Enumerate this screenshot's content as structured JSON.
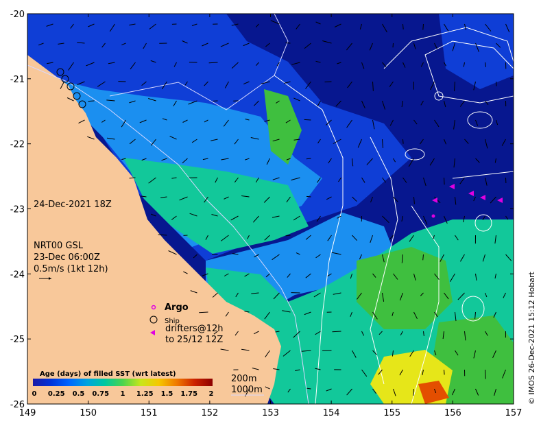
{
  "map": {
    "lon_ticks": [
      "149",
      "150",
      "151",
      "152",
      "153",
      "154",
      "155",
      "156",
      "157"
    ],
    "lat_ticks": [
      "-20",
      "-21",
      "-22",
      "-23",
      "-24",
      "-25",
      "-26"
    ],
    "lon_range": [
      149,
      157
    ],
    "lat_range": [
      -26,
      -20
    ]
  },
  "annotations": {
    "date": "24-Dec-2021 18Z",
    "nrt_line1": "NRT00 GSL",
    "nrt_line2": "23-Dec 06:00Z",
    "nrt_line3": "0.5m/s (1kt 12h)",
    "credit": "© IMOS 26-Dec-2021 15:12 Hobart"
  },
  "legend": {
    "argo": "Argo",
    "ship": "Ship",
    "drifters_line1": "drifters@12h",
    "drifters_line2": "to 25/12 12Z",
    "isobath_200": "200m",
    "isobath_1000": "1000m"
  },
  "colorbar": {
    "title": "Age (days) of filled SST (wrt latest)",
    "tick_labels": [
      "0",
      "0.25",
      "0.5",
      "0.75",
      "1",
      "1.25",
      "1.5",
      "1.75",
      "2"
    ],
    "colors": [
      "#1a1aa6",
      "#0033d9",
      "#0066ff",
      "#00a3e0",
      "#00c8a0",
      "#4dd44d",
      "#c8e61a",
      "#f5c800",
      "#f07a00",
      "#cc2200",
      "#8c0000"
    ]
  },
  "colors": {
    "land": "#f8c89a",
    "deep_blue": "#07178f",
    "mid_blue": "#0f3ed6",
    "light_blue": "#1b8ff0",
    "teal": "#12c89a",
    "green": "#3fbf3f",
    "yellow": "#e6e619",
    "argo_marker": "#e000e0"
  }
}
